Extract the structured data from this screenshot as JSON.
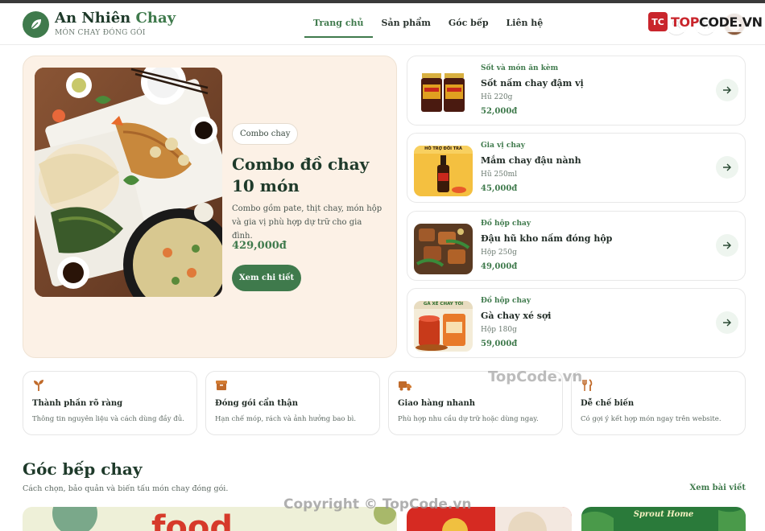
{
  "brand": {
    "name_main": "An Nhiên",
    "name_accent": "Chay",
    "tagline": "MÓN CHAY ĐÓNG GÓI"
  },
  "nav": {
    "items": [
      "Trang chủ",
      "Sản phẩm",
      "Góc bếp",
      "Liên hệ"
    ],
    "active": "Trang chủ"
  },
  "header_icons": [
    "search-icon",
    "cart-icon",
    "avatar"
  ],
  "watermark": {
    "logo_badge": "TC",
    "logo_prefix": "TOP",
    "logo_suffix": "CODE.VN",
    "center_text": "TopCode.vn",
    "footer_text": "Copyright © TopCode.vn"
  },
  "hero": {
    "tag": "Combo chay",
    "title": "Combo đồ chay 10 món",
    "description": "Combo gồm pate, thịt chay, món hộp và gia vị phù hợp dự trữ cho gia đình.",
    "price": "429,000đ",
    "button_label": "Xem chi tiết"
  },
  "products": [
    {
      "category": "Sốt và món ăn kèm",
      "name": "Sốt nấm chay đậm vị",
      "size": "Hũ 220g",
      "price": "52,000đ"
    },
    {
      "category": "Gia vị chay",
      "name": "Mắm chay đậu nành",
      "size": "Hũ 250ml",
      "price": "45,000đ",
      "thumb_label": "HỖ TRỢ ĐỔI TRẢ"
    },
    {
      "category": "Đồ hộp chay",
      "name": "Đậu hũ kho nấm đóng hộp",
      "size": "Hộp 250g",
      "price": "49,000đ"
    },
    {
      "category": "Đồ hộp chay",
      "name": "Gà chay xé sợi",
      "size": "Hộp 180g",
      "price": "59,000đ",
      "thumb_label": "GÀ XÉ CHAY TỎI"
    }
  ],
  "features": [
    {
      "icon": "sprout-icon",
      "title": "Thành phần rõ ràng",
      "desc": "Thông tin nguyên liệu và cách dùng đầy đủ."
    },
    {
      "icon": "box-icon",
      "title": "Đóng gói cẩn thận",
      "desc": "Hạn chế móp, rách và ảnh hưởng bao bì."
    },
    {
      "icon": "truck-icon",
      "title": "Giao hàng nhanh",
      "desc": "Phù hợp nhu cầu dự trữ hoặc dùng ngay."
    },
    {
      "icon": "utensils-icon",
      "title": "Dễ chế biến",
      "desc": "Có gợi ý kết hợp món ngay trên website."
    }
  ],
  "blog": {
    "title": "Góc bếp chay",
    "subtitle": "Cách chọn, bảo quản và biến tấu món chay đóng gói.",
    "link": "Xem bài viết",
    "cards": [
      {
        "label": "food"
      },
      {
        "label": ""
      },
      {
        "label": "Sprout Home"
      }
    ]
  },
  "colors": {
    "primary": "#3f7a4c",
    "hero_bg": "#fcf1e6",
    "heading": "#1e3a2a",
    "watermark_red": "#c9252c"
  }
}
